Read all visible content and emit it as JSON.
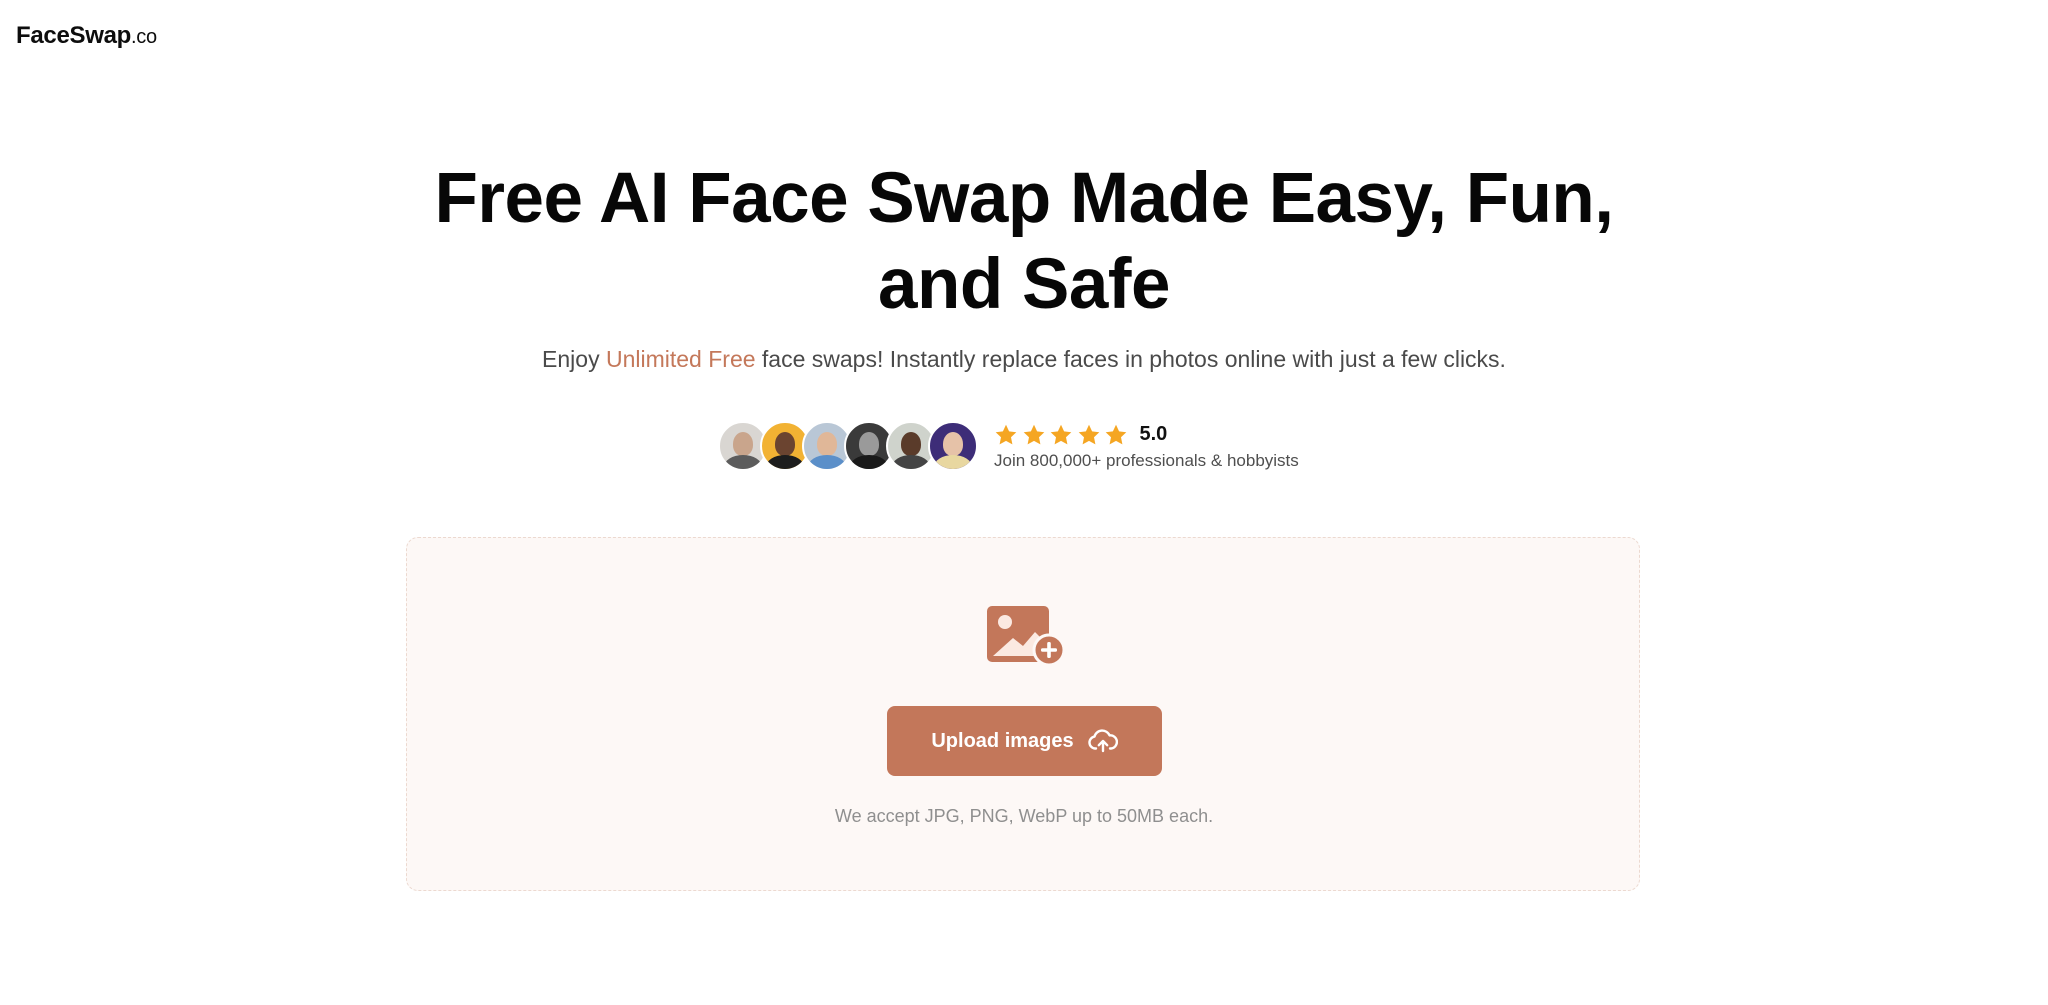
{
  "brand": {
    "name": "FaceSwap",
    "tld": ".co"
  },
  "hero": {
    "title_line1": "Free AI Face Swap Made Easy, Fun,",
    "title_line2": "and Safe",
    "subtitle_before": "Enjoy ",
    "subtitle_accent": "Unlimited Free",
    "subtitle_after": " face swaps! Instantly replace faces in photos online with just a few clicks."
  },
  "social_proof": {
    "avatar_count": 6,
    "stars": 5,
    "rating": "5.0",
    "caption": "Join 800,000+ professionals & hobbyists"
  },
  "upload": {
    "icon": "image-plus-icon",
    "button_label": "Upload images",
    "button_icon": "cloud-upload-icon",
    "note": "We accept JPG, PNG, WebP up to 50MB each."
  },
  "colors": {
    "accent": "#c3775a",
    "accent_text": "#c4785a",
    "star": "#f5a623",
    "dropzone_bg": "#fdf8f6"
  }
}
